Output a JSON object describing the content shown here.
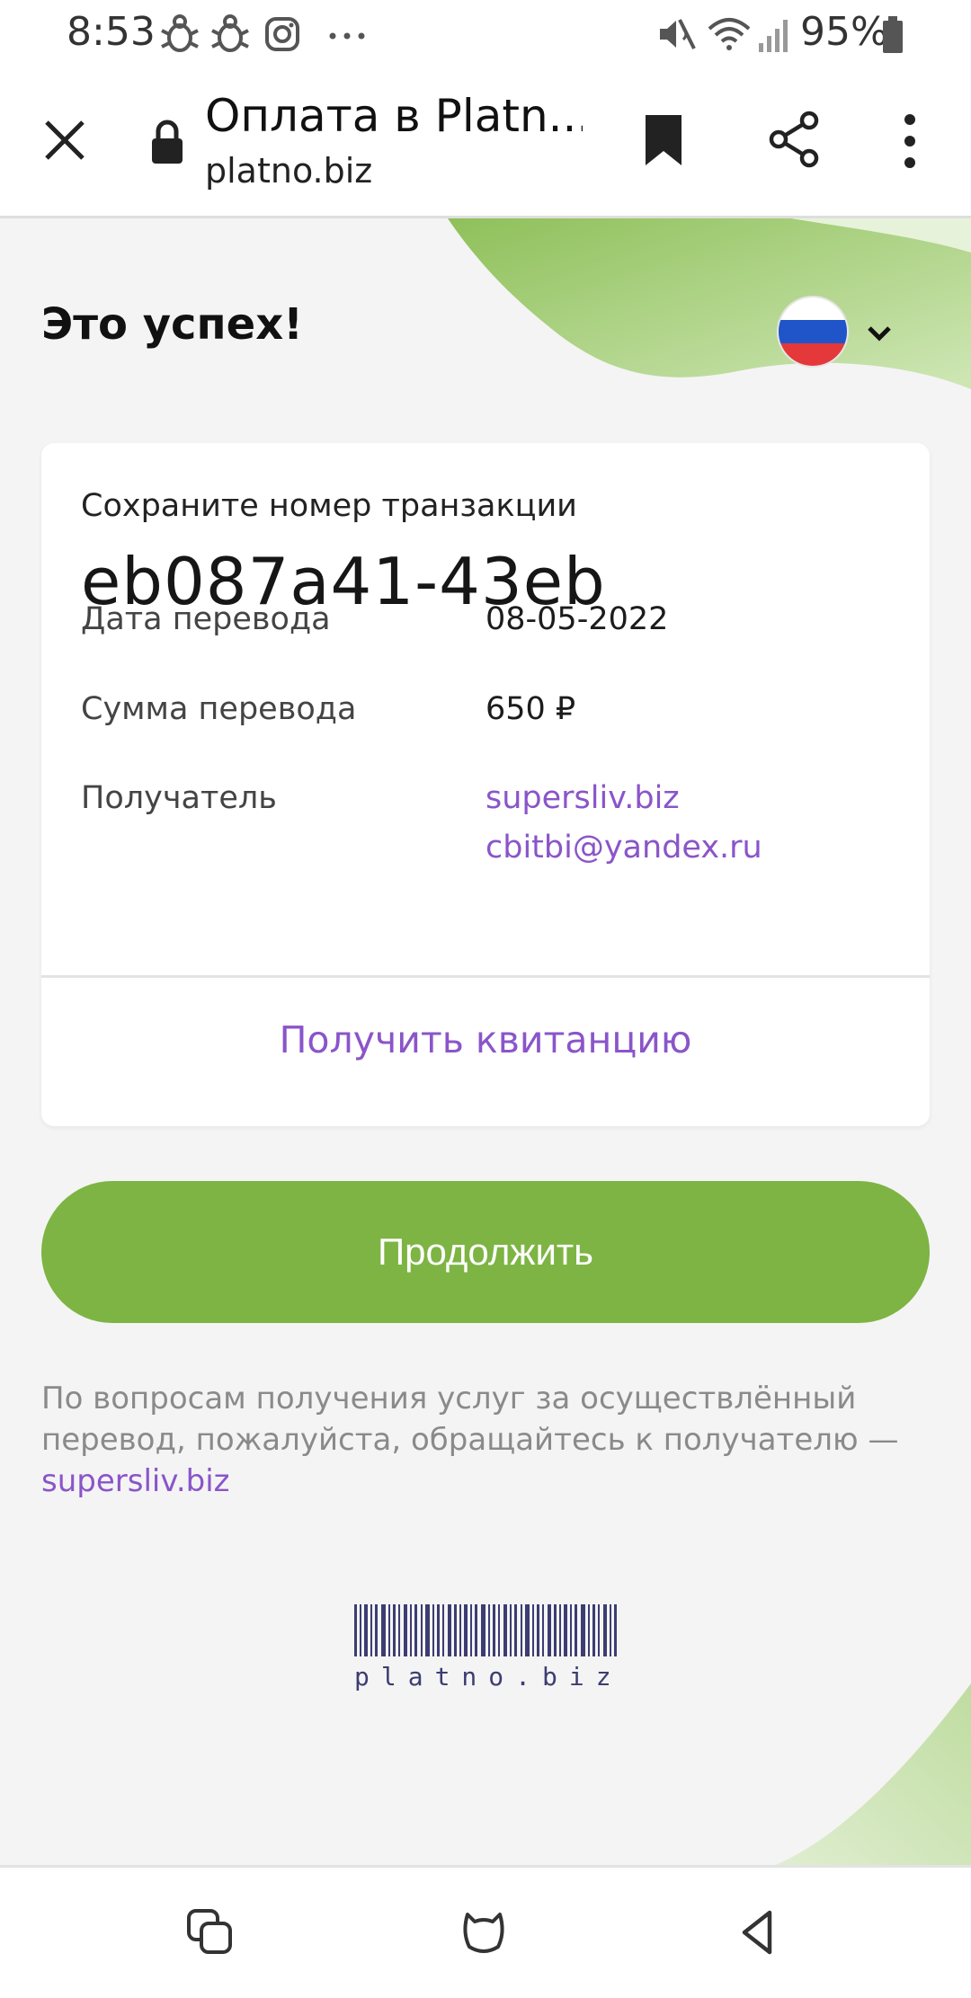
{
  "status_bar": {
    "time": "8:53",
    "battery": "95%",
    "notification_icons": [
      "bug-icon",
      "bug-icon",
      "instagram-icon",
      "more-icon"
    ],
    "system_icons": [
      "mute-icon",
      "wifi-icon",
      "signal-icon",
      "battery-icon"
    ]
  },
  "browser": {
    "title": "Оплата в Platn...",
    "url": "platno.biz"
  },
  "page": {
    "success_title": "Это успех!",
    "language_flag": "russia-flag-icon"
  },
  "card": {
    "hint": "Сохраните номер транзакции",
    "transaction_id": "eb087a41-43eb",
    "date_label": "Дата перевода",
    "date_value": "08-05-2022",
    "amount_label": "Сумма перевода",
    "amount_value": "650 ₽",
    "recipient_label": "Получатель",
    "recipient_site": "supersliv.biz",
    "recipient_email": "cbitbi@yandex.ru",
    "receipt_link": "Получить квитанцию"
  },
  "continue_button": "Продолжить",
  "info": {
    "text": "По вопросам получения услуг за осуществлённый перевод, пожалуйста, обращайтесь к получателю — ",
    "link": "supersliv.biz"
  },
  "footer": {
    "logo_text": "platno.biz"
  },
  "colors": {
    "accent_green": "#7db443",
    "link_purple": "#8a55c9"
  }
}
